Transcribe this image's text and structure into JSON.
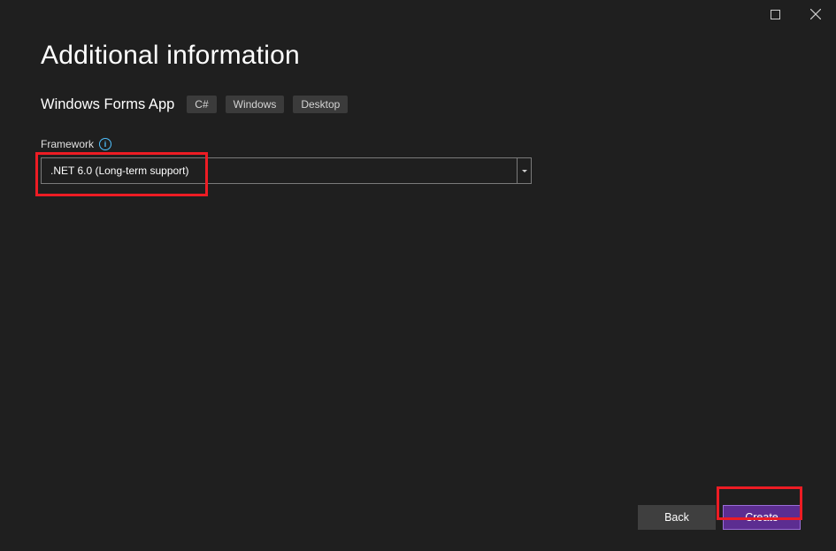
{
  "header": {
    "title": "Additional information"
  },
  "project": {
    "name": "Windows Forms App",
    "tags": [
      "C#",
      "Windows",
      "Desktop"
    ]
  },
  "framework": {
    "label": "Framework",
    "selected": ".NET 6.0 (Long-term support)"
  },
  "buttons": {
    "back": "Back",
    "create": "Create"
  }
}
